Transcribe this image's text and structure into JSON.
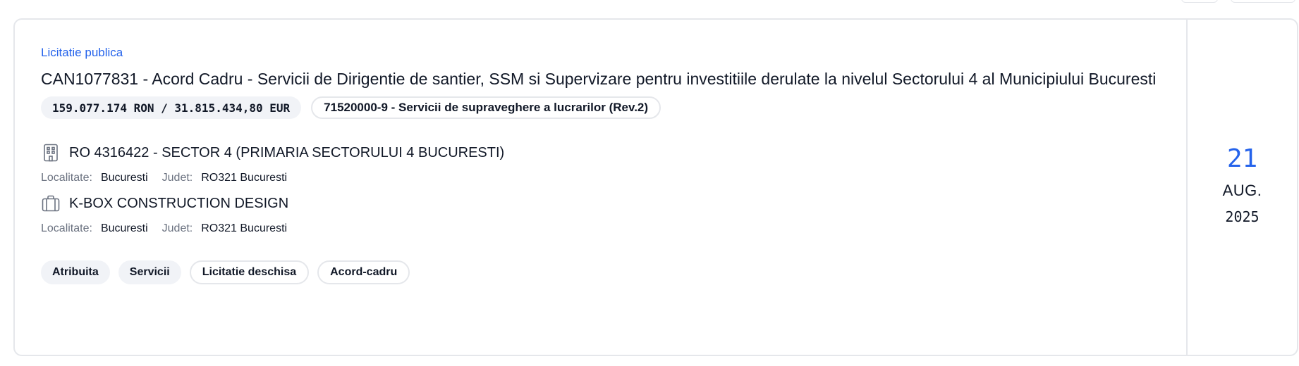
{
  "card": {
    "procedure_type": "Licitatie publica",
    "title": "CAN1077831 - Acord Cadru - Servicii de Dirigentie de santier, SSM si Supervizare pentru investitiile derulate la nivelul Sectorului 4 al Municipiului Bucuresti",
    "value": "159.077.174 RON / 31.815.434,80 EUR",
    "cpv": "71520000-9 - Servicii de supraveghere a lucrarilor (Rev.2)",
    "authority": {
      "icon": "building-icon",
      "name": "RO 4316422 - SECTOR 4 (PRIMARIA SECTORULUI 4 BUCURESTI)",
      "locality_label": "Localitate:",
      "locality": "Bucuresti",
      "county_label": "Judet:",
      "county": "RO321 Bucuresti"
    },
    "winner": {
      "icon": "briefcase-icon",
      "name": "K-BOX CONSTRUCTION DESIGN",
      "locality_label": "Localitate:",
      "locality": "Bucuresti",
      "county_label": "Judet:",
      "county": "RO321 Bucuresti"
    },
    "tags": [
      "Atribuita",
      "Servicii",
      "Licitatie deschisa",
      "Acord-cadru"
    ],
    "date": {
      "day": "21",
      "month": "AUG.",
      "year": "2025"
    }
  },
  "colors": {
    "accent": "#2563eb",
    "border": "#e5e7eb",
    "pill_bg": "#f1f3f7"
  }
}
